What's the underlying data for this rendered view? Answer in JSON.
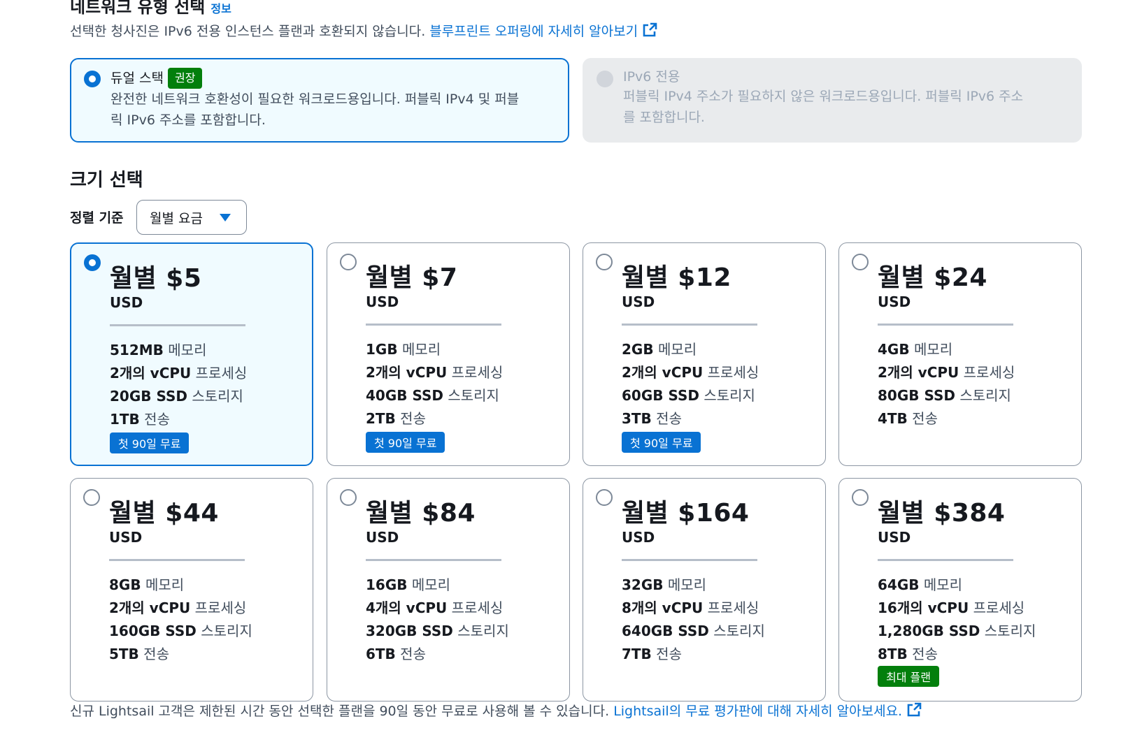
{
  "network": {
    "title": "네트워크 유형 선택",
    "info_link": "정보",
    "description": "선택한 청사진은 IPv6 전용 인스턴스 플랜과 호환되지 않습니다.",
    "description_link": "블루프린트 오퍼링에 자세히 알아보기",
    "options": [
      {
        "title": "듀얼 스택",
        "badge": "권장",
        "sub1": "완전한 네트워크 호환성이 필요한 워크로드용입니다. 퍼블릭 IPv4 및 퍼블",
        "sub2": "릭 IPv6 주소를 포함합니다."
      },
      {
        "title": "IPv6 전용",
        "sub1": "퍼블릭 IPv4 주소가 필요하지 않은 워크로드용입니다. 퍼블릭 IPv6 주소",
        "sub2": "를 포함합니다."
      }
    ]
  },
  "size": {
    "title": "크기 선택",
    "sort_label": "정렬 기준",
    "sort_value": "월별 요금"
  },
  "plans": [
    {
      "price": "월별 $5",
      "currency": "USD",
      "memory": "512MB",
      "memory_label": "메모리",
      "vcpu": "2개의 vCPU",
      "vcpu_label": "프로세싱",
      "storage": "20GB SSD",
      "storage_label": "스토리지",
      "transfer": "1TB",
      "transfer_label": "전송",
      "badge": "첫 90일 무료"
    },
    {
      "price": "월별 $7",
      "currency": "USD",
      "memory": "1GB",
      "memory_label": "메모리",
      "vcpu": "2개의 vCPU",
      "vcpu_label": "프로세싱",
      "storage": "40GB SSD",
      "storage_label": "스토리지",
      "transfer": "2TB",
      "transfer_label": "전송",
      "badge": "첫 90일 무료"
    },
    {
      "price": "월별 $12",
      "currency": "USD",
      "memory": "2GB",
      "memory_label": "메모리",
      "vcpu": "2개의 vCPU",
      "vcpu_label": "프로세싱",
      "storage": "60GB SSD",
      "storage_label": "스토리지",
      "transfer": "3TB",
      "transfer_label": "전송",
      "badge": "첫 90일 무료"
    },
    {
      "price": "월별 $24",
      "currency": "USD",
      "memory": "4GB",
      "memory_label": "메모리",
      "vcpu": "2개의 vCPU",
      "vcpu_label": "프로세싱",
      "storage": "80GB SSD",
      "storage_label": "스토리지",
      "transfer": "4TB",
      "transfer_label": "전송"
    },
    {
      "price": "월별 $44",
      "currency": "USD",
      "memory": "8GB",
      "memory_label": "메모리",
      "vcpu": "2개의 vCPU",
      "vcpu_label": "프로세싱",
      "storage": "160GB SSD",
      "storage_label": "스토리지",
      "transfer": "5TB",
      "transfer_label": "전송"
    },
    {
      "price": "월별 $84",
      "currency": "USD",
      "memory": "16GB",
      "memory_label": "메모리",
      "vcpu": "4개의 vCPU",
      "vcpu_label": "프로세싱",
      "storage": "320GB SSD",
      "storage_label": "스토리지",
      "transfer": "6TB",
      "transfer_label": "전송"
    },
    {
      "price": "월별 $164",
      "currency": "USD",
      "memory": "32GB",
      "memory_label": "메모리",
      "vcpu": "8개의 vCPU",
      "vcpu_label": "프로세싱",
      "storage": "640GB SSD",
      "storage_label": "스토리지",
      "transfer": "7TB",
      "transfer_label": "전송"
    },
    {
      "price": "월별 $384",
      "currency": "USD",
      "memory": "64GB",
      "memory_label": "메모리",
      "vcpu": "16개의 vCPU",
      "vcpu_label": "프로세싱",
      "storage": "1,280GB SSD",
      "storage_label": "스토리지",
      "transfer": "8TB",
      "transfer_label": "전송",
      "badge_max": "최대 플랜"
    }
  ],
  "footer": {
    "text": "신규 Lightsail 고객은 제한된 시간 동안 선택한 플랜을 90일 동안 무료로 사용해 볼 수 있습니다.",
    "link": "Lightsail의 무료 평가판에 대해 자세히 알아보세요."
  },
  "colors": {
    "accent": "#0972d3",
    "recommended": "#037f0c",
    "selected_bg": "#f0fbff"
  }
}
